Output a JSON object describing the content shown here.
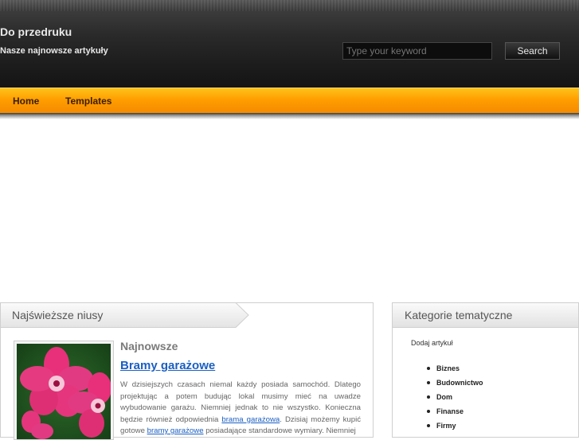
{
  "header": {
    "site_title": "Do przedruku",
    "site_description": "Nasze najnowsze artykuły",
    "search_placeholder": "Type your keyword",
    "search_button": "Search"
  },
  "nav": {
    "items": [
      {
        "label": "Home"
      },
      {
        "label": "Templates"
      }
    ]
  },
  "main": {
    "tab_title": "Najświeższe niusy",
    "section_label": "Najnowsze",
    "article": {
      "title": "Bramy garażowe",
      "body_1": "W dzisiejszych czasach niemal każdy posiada samochód. Dlatego projektując a potem budując lokal musimy mieć na uwadze wybudowanie garażu. Niemniej jednak to nie wszystko. Konieczna będzie również odpowiednia ",
      "link_1": "brama garażowa",
      "body_2": ". Dzisiaj możemy kupić gotowe ",
      "link_2": "bramy garażowe",
      "body_3": " posiadające standardowe wymiary. Niemniej"
    }
  },
  "sidebar": {
    "title": "Kategorie tematyczne",
    "add_article": "Dodaj artykuł",
    "categories": [
      "Biznes",
      "Budownictwo",
      "Dom",
      "Finanse",
      "Firmy"
    ]
  }
}
